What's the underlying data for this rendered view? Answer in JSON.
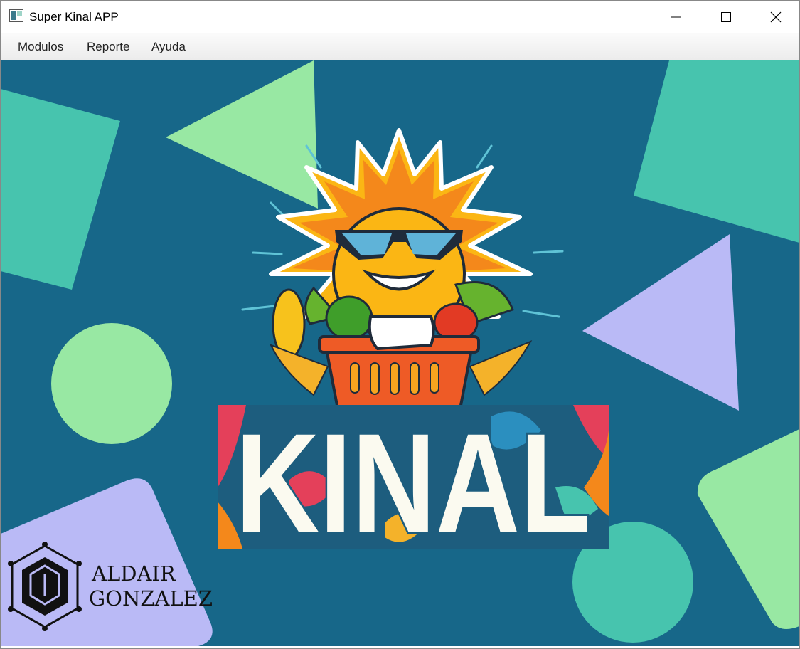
{
  "window": {
    "title": "Super Kinal APP",
    "controls": {
      "minimize": "minimize-icon",
      "maximize": "maximize-icon",
      "close": "close-icon"
    }
  },
  "menu": {
    "items": [
      {
        "label": "Modulos"
      },
      {
        "label": "Reporte"
      },
      {
        "label": "Ayuda"
      }
    ]
  },
  "main": {
    "logo_text": "KINAL",
    "author_first": "ALDAIR",
    "author_last": "GONZALEZ",
    "colors": {
      "background": "#176789",
      "teal": "#47c4ae",
      "mint": "#98e8a3",
      "lavender": "#babaf6",
      "sun": "#fbb614",
      "basket": "#ee5b26",
      "logo_letters": "#fbfaf0"
    }
  }
}
